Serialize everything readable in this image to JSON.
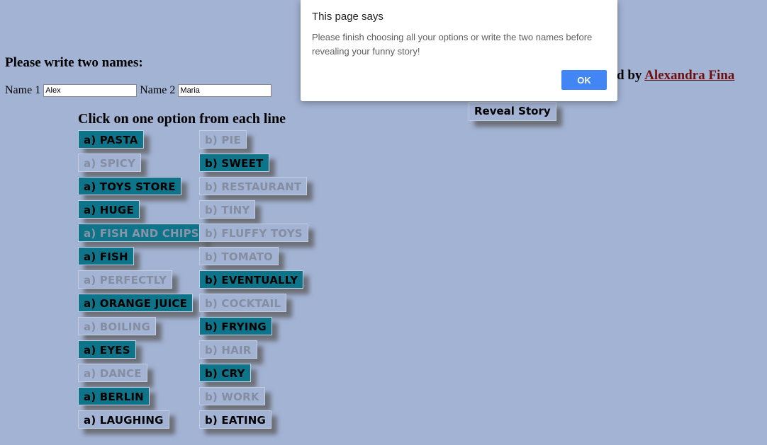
{
  "names": {
    "heading": "Please write two names:",
    "name1_label": "Name 1",
    "name1_value": "Alex",
    "name2_label": "Name 2",
    "name2_value": "Maria"
  },
  "credit": {
    "prefix": "ped by",
    "author": "Alexandra Fina"
  },
  "reveal_button": "Reveal Story",
  "options_heading": "Click on one option from each line",
  "options_a": [
    {
      "label": "a) PASTA",
      "state": "sel"
    },
    {
      "label": "a) SPICY",
      "state": "unsel"
    },
    {
      "label": "a) TOYS STORE",
      "state": "sel"
    },
    {
      "label": "a) HUGE",
      "state": "sel"
    },
    {
      "label": "a) FISH AND CHIPS",
      "state": "selfade"
    },
    {
      "label": "a) FISH",
      "state": "sel"
    },
    {
      "label": "a) PERFECTLY",
      "state": "unsel"
    },
    {
      "label": "a) ORANGE JUICE",
      "state": "sel"
    },
    {
      "label": "a) BOILING",
      "state": "unsel"
    },
    {
      "label": "a) EYES",
      "state": "sel"
    },
    {
      "label": "a) DANCE",
      "state": "unsel"
    },
    {
      "label": "a) BERLIN",
      "state": "sel"
    },
    {
      "label": "a) LAUGHING",
      "state": "plain"
    }
  ],
  "options_b": [
    {
      "label": "b) PIE",
      "state": "unsel"
    },
    {
      "label": "b) SWEET",
      "state": "sel"
    },
    {
      "label": "b) RESTAURANT",
      "state": "unsel"
    },
    {
      "label": "b) TINY",
      "state": "unsel"
    },
    {
      "label": "b) FLUFFY TOYS",
      "state": "unsel"
    },
    {
      "label": "b) TOMATO",
      "state": "unsel"
    },
    {
      "label": "b) EVENTUALLY",
      "state": "sel"
    },
    {
      "label": "b) COCKTAIL",
      "state": "unsel"
    },
    {
      "label": "b) FRYING",
      "state": "sel"
    },
    {
      "label": "b) HAIR",
      "state": "unsel"
    },
    {
      "label": "b) CRY",
      "state": "sel"
    },
    {
      "label": "b) WORK",
      "state": "unsel"
    },
    {
      "label": "b) EATING",
      "state": "plain"
    }
  ],
  "dialog": {
    "title": "This page says",
    "message": "Please finish choosing all your options or write the two names before revealing your funny story!",
    "ok": "OK"
  },
  "colors": {
    "background": "#a3b3d4",
    "selected": "#0e7489",
    "link": "#6b0f0f",
    "ok_button": "#4285f4"
  }
}
